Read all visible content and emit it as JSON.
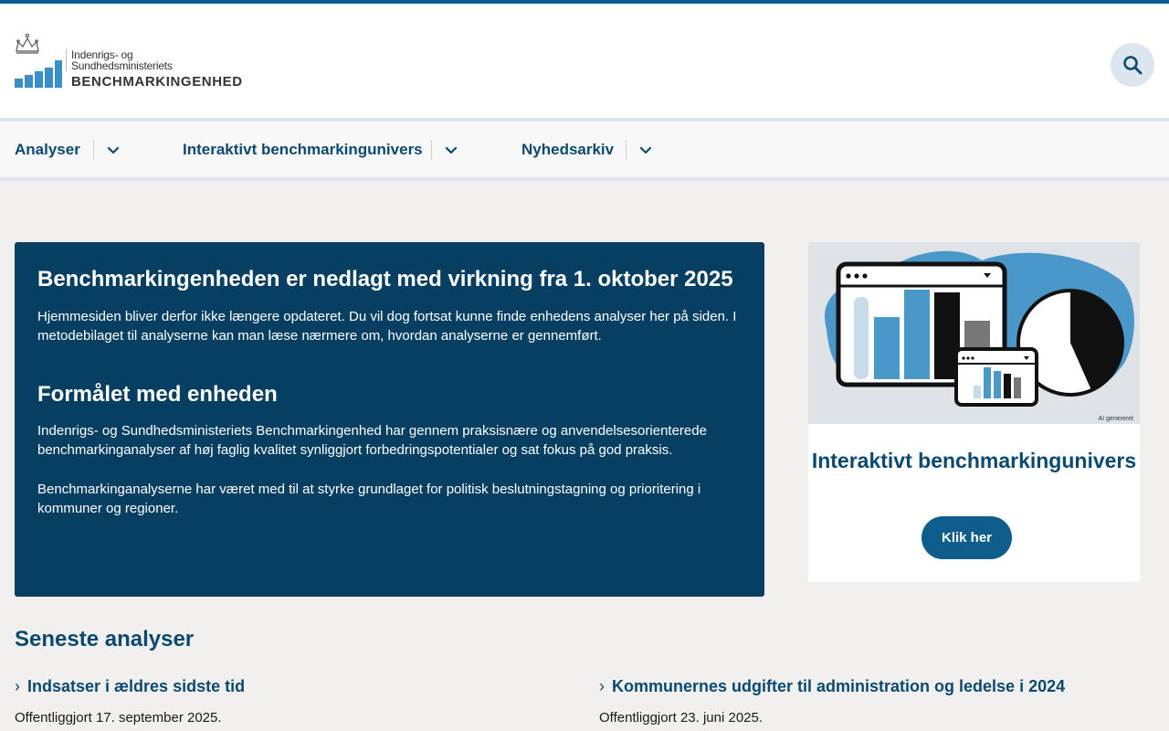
{
  "header": {
    "logo": {
      "line1": "Indenrigs- og",
      "line2": "Sundhedsministeriets",
      "line3": "BENCHMARKINGENHED"
    },
    "search_icon": "search-icon"
  },
  "nav": {
    "items": [
      {
        "label": "Analyser"
      },
      {
        "label": "Interaktivt benchmarkingunivers"
      },
      {
        "label": "Nyhedsarkiv"
      }
    ]
  },
  "hero": {
    "title": "Benchmarkingenheden er nedlagt med virkning fra 1. oktober 2025",
    "intro": "Hjemmesiden bliver derfor ikke længere opdateret. Du vil dog fortsat kunne finde enhedens analyser her på siden. I metodebilaget til analyserne kan man læse nærmere om, hvordan analyserne er gennemført.",
    "subtitle": "Formålet med enheden",
    "paragraph1": "Indenrigs- og Sundhedsministeriets Benchmarkingenhed har gennem praksisnære og anvendelsesorienterede benchmarkinganalyser af høj faglig kvalitet synliggjort forbedringspotentialer og sat fokus på god praksis.",
    "paragraph2": "Benchmarkinganalyserne har været med til at styrke grundlaget for politisk beslutningstagning og prioritering i kommuner og regioner."
  },
  "card": {
    "image_tag": "AI genereret",
    "title": "Interaktivt benchmarkingunivers",
    "button_label": "Klik her"
  },
  "latest": {
    "title": "Seneste analyser",
    "articles": [
      {
        "title": "Indsatser i ældres sidste tid",
        "date": "Offentliggjort 17. september 2025."
      },
      {
        "title": "Kommunernes udgifter til administration og ledelse i 2024",
        "date": "Offentliggjort 23. juni 2025."
      }
    ]
  },
  "colors": {
    "brand_blue": "#0e5d8c",
    "hero_bg": "#073f63",
    "page_bg": "#f2f0ee"
  }
}
